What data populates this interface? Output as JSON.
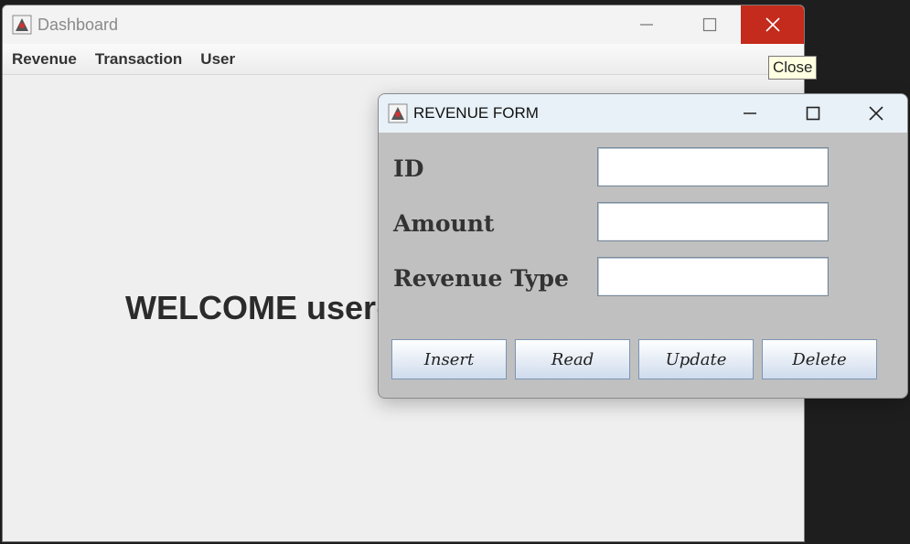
{
  "dashboard": {
    "title": "Dashboard",
    "menu": [
      "Revenue",
      "Transaction",
      "User"
    ],
    "welcome": "WELCOME user("
  },
  "tooltip": {
    "text": "Close"
  },
  "revenue_form": {
    "title": "REVENUE FORM",
    "fields": [
      {
        "label": "ID",
        "value": ""
      },
      {
        "label": "Amount",
        "value": ""
      },
      {
        "label": "Revenue Type",
        "value": ""
      }
    ],
    "buttons": [
      "Insert",
      "Read",
      "Update",
      "Delete"
    ]
  },
  "colors": {
    "close_hover": "#c42b1c",
    "form_bg": "#c0c0c0",
    "form_titlebar": "#e8f1f7",
    "tooltip_bg": "#ffffe1"
  }
}
